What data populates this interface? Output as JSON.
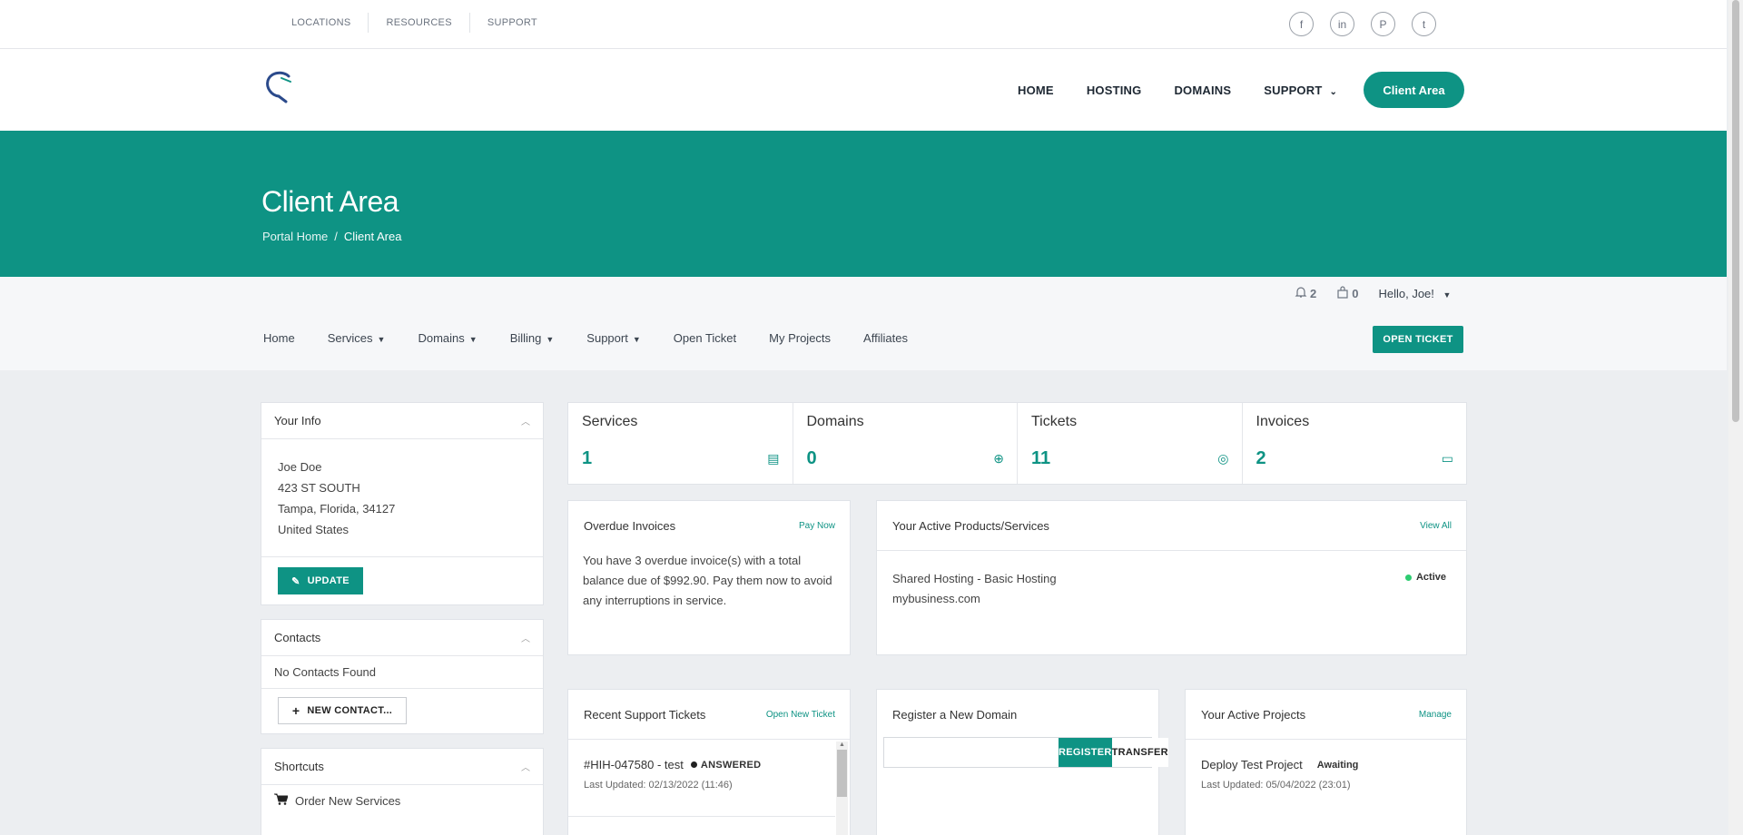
{
  "topbar": {
    "links": [
      "LOCATIONS",
      "RESOURCES",
      "SUPPORT"
    ],
    "social": [
      {
        "icon": "facebook-icon",
        "glyph": "f"
      },
      {
        "icon": "linkedin-icon",
        "glyph": "in"
      },
      {
        "icon": "pinterest-icon",
        "glyph": "P"
      },
      {
        "icon": "twitter-icon",
        "glyph": "t"
      }
    ]
  },
  "header": {
    "nav": [
      "HOME",
      "HOSTING",
      "DOMAINS",
      "SUPPORT"
    ],
    "client_area_button": "Client Area"
  },
  "hero": {
    "title": "Client Area",
    "breadcrumb_home": "Portal Home",
    "breadcrumb_sep": "/",
    "breadcrumb_current": "Client Area"
  },
  "userbar": {
    "notifications": "2",
    "cart": "0",
    "greeting": "Hello, Joe!"
  },
  "secnav": {
    "items": [
      "Home",
      "Services",
      "Domains",
      "Billing",
      "Support",
      "Open Ticket",
      "My Projects",
      "Affiliates"
    ],
    "open_ticket_button": "OPEN TICKET"
  },
  "your_info": {
    "title": "Your Info",
    "name": "Joe Doe",
    "address1": "423 ST SOUTH",
    "address2": "Tampa, Florida, 34127",
    "country": "United States",
    "update_button": "UPDATE"
  },
  "contacts": {
    "title": "Contacts",
    "empty": "No Contacts Found",
    "new_button": "NEW CONTACT..."
  },
  "shortcuts": {
    "title": "Shortcuts",
    "item": "Order New Services"
  },
  "stats": [
    {
      "label": "Services",
      "value": "1",
      "icon": "server-icon",
      "glyph": "▤"
    },
    {
      "label": "Domains",
      "value": "0",
      "icon": "globe-icon",
      "glyph": "⊕"
    },
    {
      "label": "Tickets",
      "value": "11",
      "icon": "lifebuoy-icon",
      "glyph": "◎"
    },
    {
      "label": "Invoices",
      "value": "2",
      "icon": "billing-icon",
      "glyph": "▭"
    }
  ],
  "overdue": {
    "title": "Overdue Invoices",
    "link": "Pay Now",
    "text": "You have 3 overdue invoice(s) with a total balance due of $992.90. Pay them now to avoid any interruptions in service."
  },
  "products": {
    "title": "Your Active Products/Services",
    "link": "View All",
    "item_name": "Shared Hosting - Basic Hosting",
    "item_domain": "mybusiness.com",
    "status": "Active",
    "status_color": "#2ecc71"
  },
  "tickets": {
    "title": "Recent Support Tickets",
    "link": "Open New Ticket",
    "ticket_id": "#HIH-047580 - test",
    "ticket_status": "ANSWERED",
    "updated": "Last Updated: 02/13/2022 (11:46)"
  },
  "domain_reg": {
    "title": "Register a New Domain",
    "register_button": "REGISTER",
    "transfer_button": "TRANSFER"
  },
  "projects": {
    "title": "Your Active Projects",
    "link": "Manage",
    "project_name": "Deploy Test Project",
    "project_status": "Awaiting",
    "updated": "Last Updated: 05/04/2022 (23:01)"
  },
  "colors": {
    "accent": "#0e9384",
    "page_bg": "#eceef1"
  }
}
